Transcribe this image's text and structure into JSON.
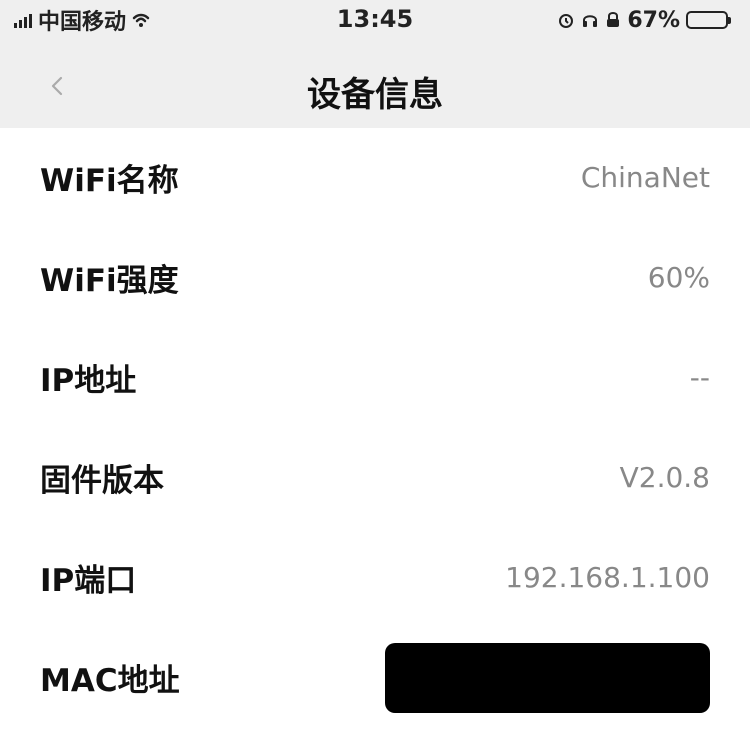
{
  "status_bar": {
    "carrier": "中国移动",
    "time": "13:45",
    "battery_percent": "67%",
    "icons": [
      "signal-icon",
      "wifi-icon",
      "alarm-icon",
      "headphones-icon",
      "lock-icon",
      "battery-icon"
    ]
  },
  "nav": {
    "title": "设备信息"
  },
  "info": {
    "rows": [
      {
        "label": "WiFi名称",
        "value": "ChinaNet"
      },
      {
        "label": "WiFi强度",
        "value": "60%"
      },
      {
        "label": "IP地址",
        "value": "--"
      },
      {
        "label": "固件版本",
        "value": "V2.0.8"
      },
      {
        "label": "IP端口",
        "value": "192.168.1.100"
      },
      {
        "label": "MAC地址",
        "value": ""
      }
    ]
  },
  "colors": {
    "header_background": "#efefef",
    "page_background": "#ffffff",
    "secondary_text": "#888888",
    "redacted_block": "#000000"
  }
}
